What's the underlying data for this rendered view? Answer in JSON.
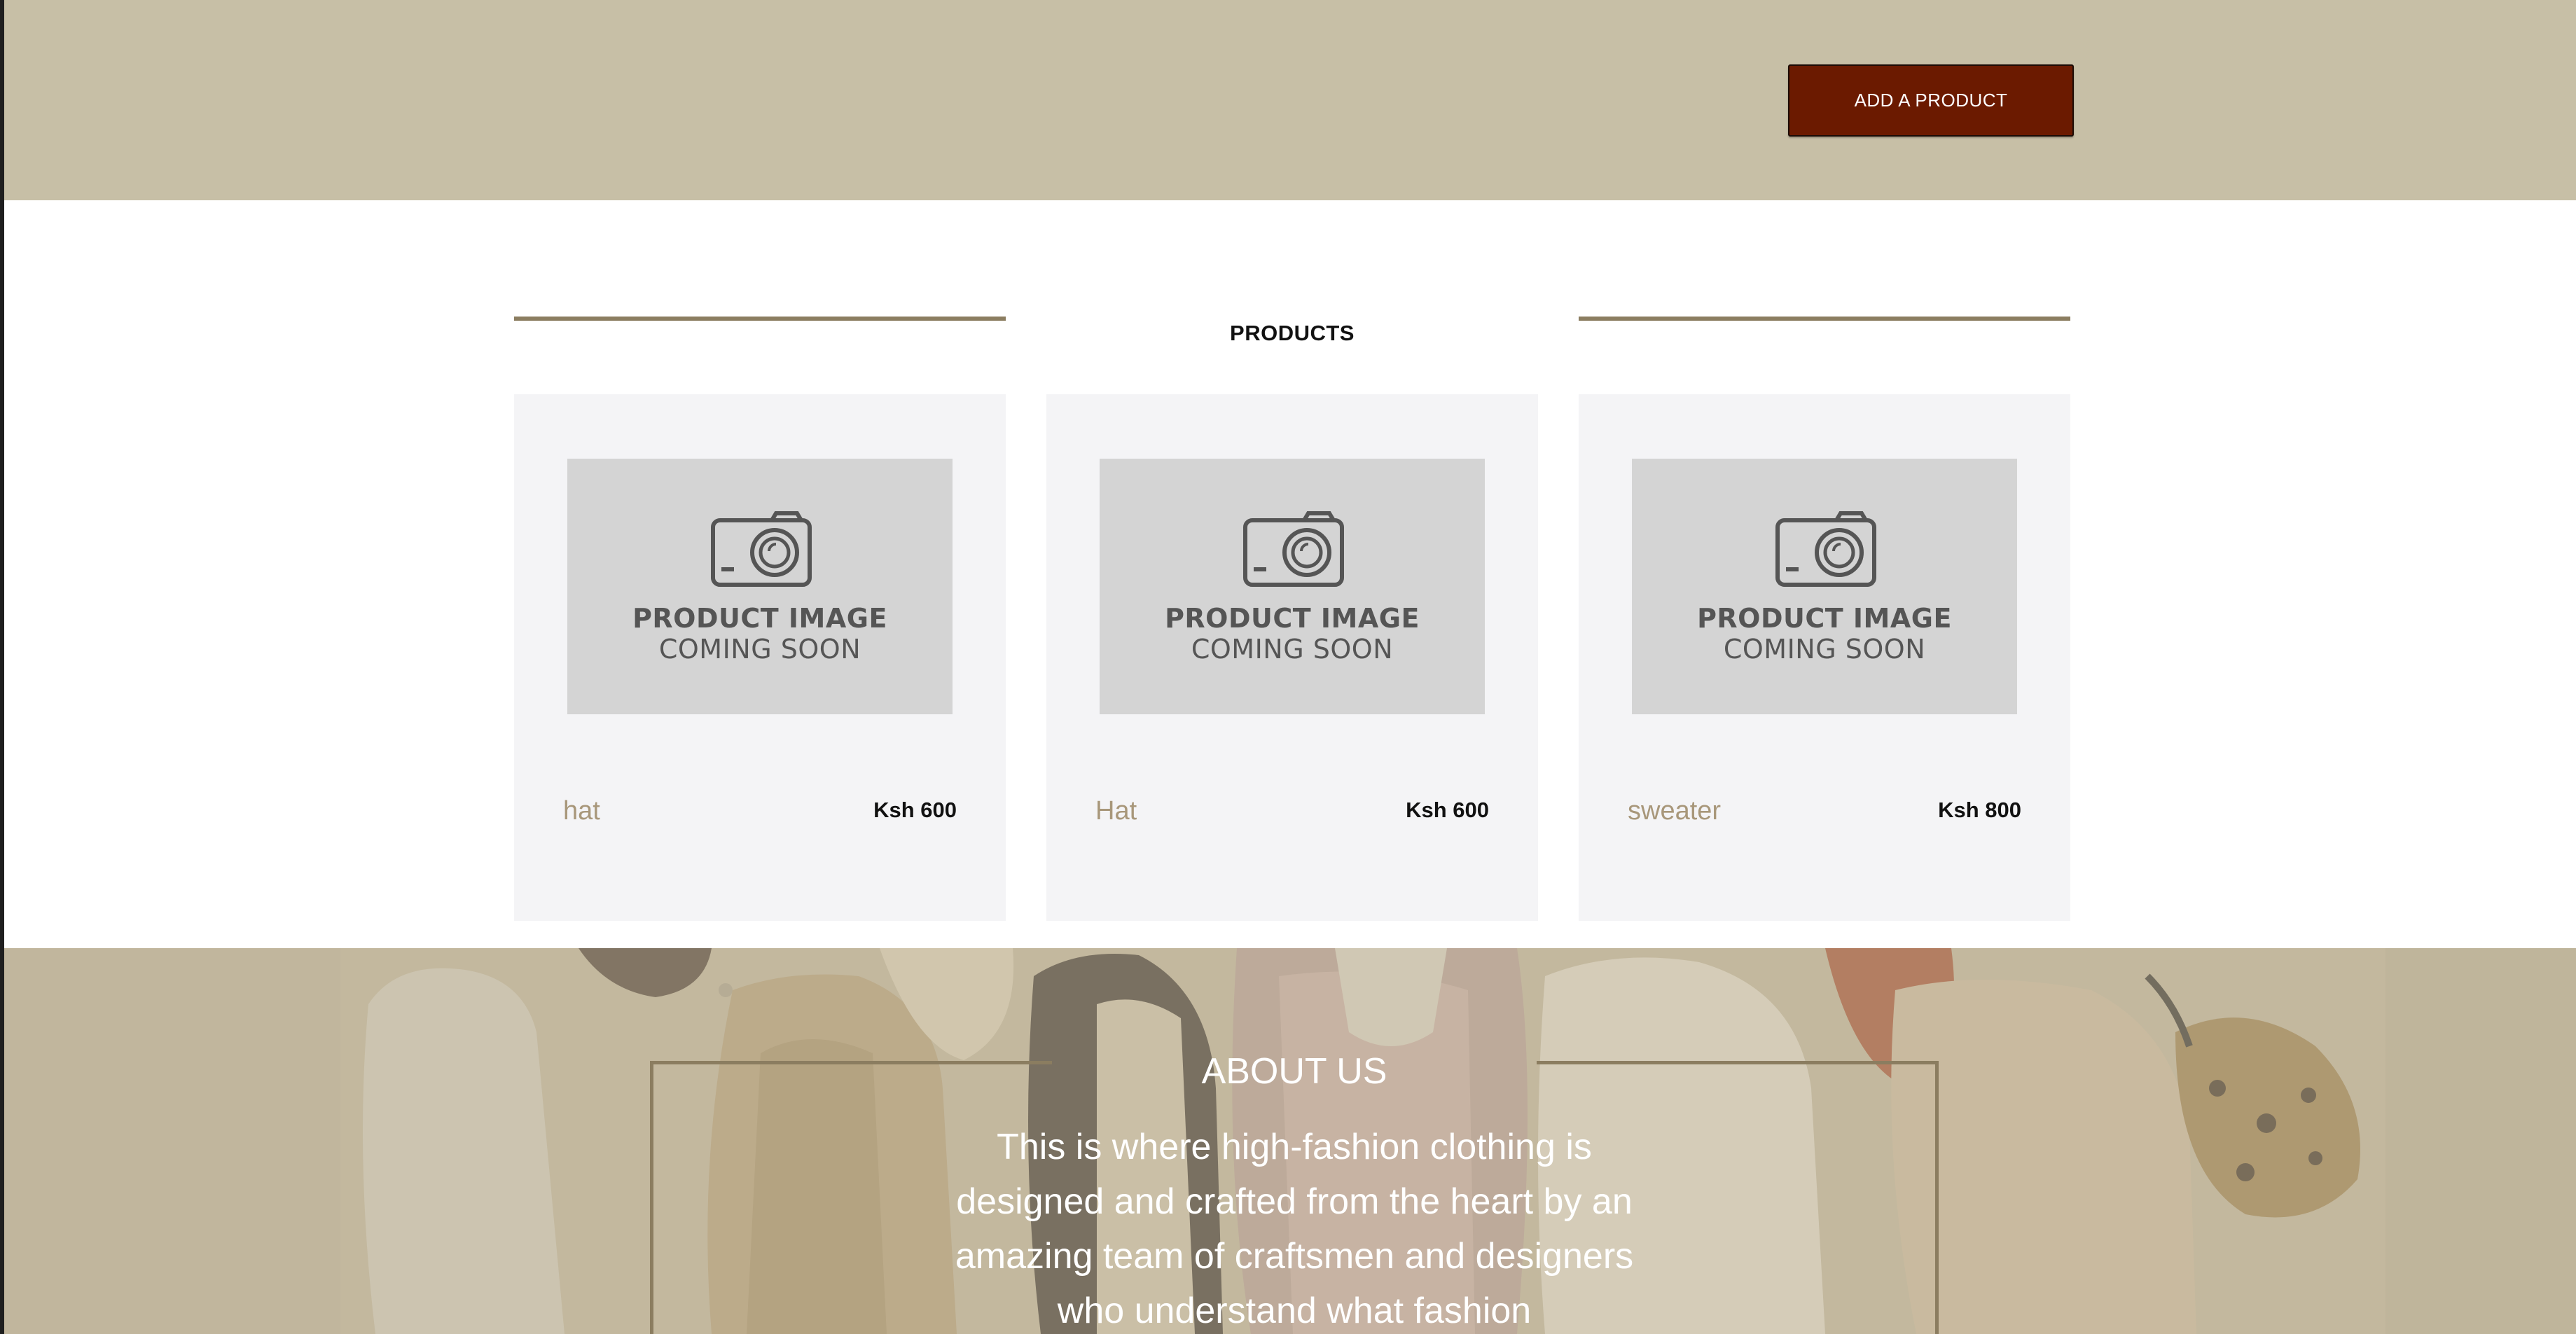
{
  "header": {
    "add_product_label": "ADD A PRODUCT"
  },
  "products": {
    "title": "PRODUCTS",
    "placeholder": {
      "line1": "PRODUCT IMAGE",
      "line2": "COMING SOON"
    },
    "items": [
      {
        "name": "hat",
        "price": "Ksh 600"
      },
      {
        "name": "Hat",
        "price": "Ksh 600"
      },
      {
        "name": "sweater",
        "price": "Ksh 800"
      }
    ]
  },
  "about": {
    "title": "ABOUT US",
    "text": "This is where high-fashion clothing is designed and crafted from the heart by an amazing team of craftsmen and designers who understand what fashion"
  },
  "colors": {
    "header_bg": "#c7bfa6",
    "button_bg": "#6b1a00",
    "accent_rule": "#8b7d60",
    "product_name": "#a8977a",
    "card_bg": "#f4f4f6"
  }
}
